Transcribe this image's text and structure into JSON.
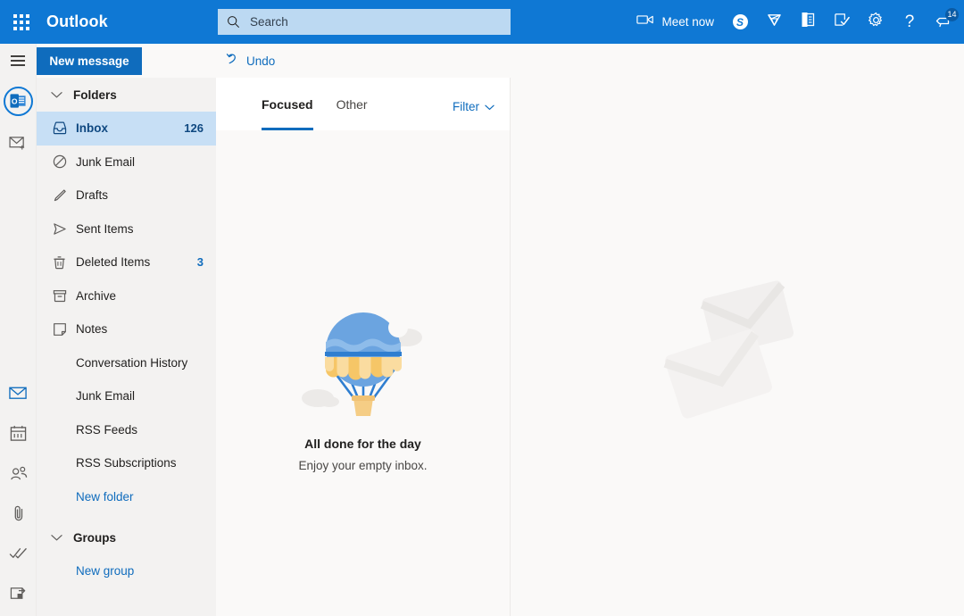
{
  "header": {
    "brand": "Outlook",
    "waffle_icon": "app-launcher-waffle-icon",
    "search": {
      "placeholder": "Search",
      "value": "",
      "icon": "search-icon"
    },
    "actions": [
      {
        "id": "meet-now",
        "icon": "video-camera-icon",
        "label": "Meet now"
      },
      {
        "id": "skype",
        "icon": "skype-icon",
        "label": "S"
      },
      {
        "id": "premium",
        "icon": "diamond-premium-icon",
        "label": ""
      },
      {
        "id": "office-note",
        "icon": "office-note-icon",
        "label": ""
      },
      {
        "id": "tasks",
        "icon": "note-checkmark-icon",
        "label": ""
      },
      {
        "id": "settings",
        "icon": "gear-icon",
        "label": ""
      },
      {
        "id": "help",
        "icon": "question-mark-icon",
        "label": "?"
      },
      {
        "id": "feedback",
        "icon": "feedback-speech-icon",
        "label": "",
        "badge": "14"
      }
    ]
  },
  "rail": {
    "hamburger_icon": "hamburger-menu-icon",
    "account_icon": "outlook-account-icon",
    "new_mail_icon": "new-mail-icon",
    "items": [
      {
        "id": "mail",
        "icon": "mail-icon",
        "active": true
      },
      {
        "id": "calendar",
        "icon": "calendar-icon",
        "active": false
      },
      {
        "id": "people",
        "icon": "people-icon",
        "active": false
      },
      {
        "id": "files",
        "icon": "paperclip-files-icon",
        "active": false
      },
      {
        "id": "todo",
        "icon": "checkmark-todo-icon",
        "active": false
      },
      {
        "id": "apps",
        "icon": "apps-switch-icon",
        "active": false
      }
    ]
  },
  "sidebar": {
    "new_message_label": "New message",
    "folders_header": "Folders",
    "groups_header": "Groups",
    "folders": [
      {
        "label": "Inbox",
        "count": "126",
        "icon": "inbox-icon",
        "selected": true,
        "indent": false,
        "link": false
      },
      {
        "label": "Junk Email",
        "count": "",
        "icon": "block-circle-icon",
        "selected": false,
        "indent": false,
        "link": false
      },
      {
        "label": "Drafts",
        "count": "",
        "icon": "pencil-icon",
        "selected": false,
        "indent": false,
        "link": false
      },
      {
        "label": "Sent Items",
        "count": "",
        "icon": "send-arrow-icon",
        "selected": false,
        "indent": false,
        "link": false
      },
      {
        "label": "Deleted Items",
        "count": "3",
        "icon": "trash-icon",
        "selected": false,
        "indent": false,
        "link": false
      },
      {
        "label": "Archive",
        "count": "",
        "icon": "archive-box-icon",
        "selected": false,
        "indent": false,
        "link": false
      },
      {
        "label": "Notes",
        "count": "",
        "icon": "note-icon",
        "selected": false,
        "indent": false,
        "link": false
      },
      {
        "label": "Conversation History",
        "count": "",
        "icon": "",
        "selected": false,
        "indent": true,
        "link": false
      },
      {
        "label": "Junk Email",
        "count": "",
        "icon": "",
        "selected": false,
        "indent": true,
        "link": false
      },
      {
        "label": "RSS Feeds",
        "count": "",
        "icon": "",
        "selected": false,
        "indent": true,
        "link": false
      },
      {
        "label": "RSS Subscriptions",
        "count": "",
        "icon": "",
        "selected": false,
        "indent": true,
        "link": false
      },
      {
        "label": "New folder",
        "count": "",
        "icon": "",
        "selected": false,
        "indent": true,
        "link": true
      }
    ],
    "groups": [
      {
        "label": "New group",
        "count": "",
        "icon": "",
        "selected": false,
        "indent": true,
        "link": true
      }
    ]
  },
  "toolbar": {
    "undo_label": "Undo",
    "undo_icon": "undo-arrow-icon"
  },
  "message_list": {
    "tabs": [
      {
        "label": "Focused",
        "active": true
      },
      {
        "label": "Other",
        "active": false
      }
    ],
    "filter_label": "Filter",
    "filter_chevron_icon": "chevron-down-icon",
    "empty_state": {
      "illustration": "hot-air-balloon-illustration",
      "title": "All done for the day",
      "subtitle": "Enjoy your empty inbox."
    }
  },
  "reading_pane": {
    "watermark_icon": "two-envelopes-watermark"
  },
  "colors": {
    "brand_blue": "#0f78d4",
    "button_blue": "#0f6cbd",
    "selected_row": "#c7dff5",
    "sidebar_bg": "#f3f2f1",
    "pane_bg": "#faf9f8",
    "text_primary": "#201f1e",
    "text_secondary": "#484644",
    "balloon_blue": "#6ba4e0",
    "balloon_yellow": "#f6c667",
    "balloon_basket": "#f5cd85"
  }
}
